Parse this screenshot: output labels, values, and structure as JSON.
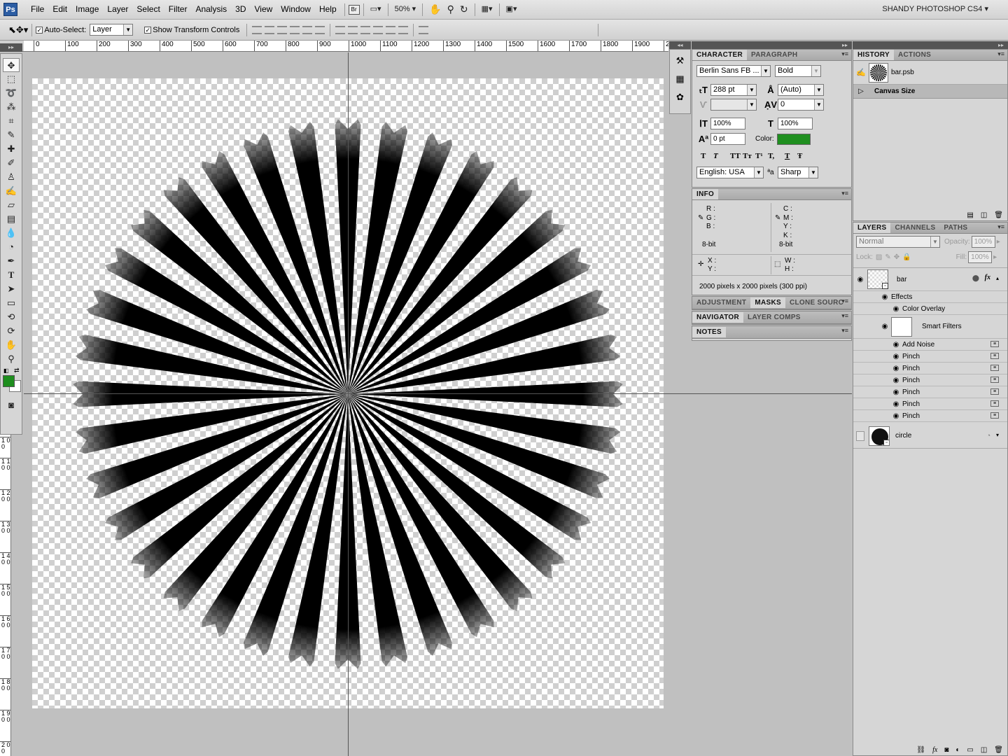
{
  "app": {
    "logo": "Ps",
    "menus": [
      "File",
      "Edit",
      "Image",
      "Layer",
      "Select",
      "Filter",
      "Analysis",
      "3D",
      "View",
      "Window",
      "Help"
    ],
    "bridge_label": "Br",
    "zoom": "50%",
    "workspace": "SHANDY PHOTOSHOP CS4"
  },
  "options": {
    "auto_select_label": "Auto-Select:",
    "auto_select_value": "Layer",
    "show_transform_label": "Show Transform Controls"
  },
  "ruler": {
    "top_ticks": [
      "0",
      "100",
      "200",
      "300",
      "400",
      "500",
      "600",
      "700",
      "800",
      "900",
      "1000",
      "1100",
      "1200",
      "1300",
      "1400",
      "1500",
      "1600",
      "1700",
      "1800",
      "1900",
      "2"
    ],
    "left_ticks": [
      "1 0 0",
      "1 1 0 0",
      "1 2 0 0",
      "1 3 0 0",
      "1 4 0 0",
      "1 5 0 0",
      "1 6 0 0",
      "1 7 0 0",
      "1 8 0 0",
      "1 9 0 0",
      "2 0 0"
    ]
  },
  "tools": [
    "move",
    "marquee",
    "lasso",
    "magic-wand",
    "crop",
    "eyedropper",
    "healing",
    "brush",
    "stamp",
    "history-brush",
    "eraser",
    "gradient",
    "blur",
    "dodge",
    "pen",
    "type",
    "path-select",
    "shape",
    "3d-rotate",
    "3d-orbit",
    "hand",
    "zoom"
  ],
  "colors": {
    "foreground": "#1e8e1e",
    "background": "#ffffff",
    "char_color": "#1f8f1f"
  },
  "character": {
    "tabs": [
      "CHARACTER",
      "PARAGRAPH"
    ],
    "font_family": "Berlin Sans FB ...",
    "font_style": "Bold",
    "size": "288 pt",
    "leading": "(Auto)",
    "kerning": "",
    "tracking": "0",
    "vscale": "100%",
    "hscale": "100%",
    "baseline": "0 pt",
    "color_label": "Color:",
    "language": "English: USA",
    "aa_label": "ªa",
    "antialias": "Sharp",
    "style_buttons": [
      "T",
      "T",
      "TT",
      "Tт",
      "T¹",
      "T,",
      "T",
      "Ŧ"
    ]
  },
  "info": {
    "tab": "INFO",
    "rgb": [
      "R :",
      "G :",
      "B :"
    ],
    "cmyk": [
      "C :",
      "M :",
      "Y :",
      "K :"
    ],
    "bit_left": "8-bit",
    "bit_right": "8-bit",
    "xy": [
      "X :",
      "Y :"
    ],
    "wh": [
      "W :",
      "H :"
    ],
    "doc_info": "2000 pixels x 2000 pixels (300 ppi)"
  },
  "collapsed_panels": [
    {
      "tabs": [
        "ADJUSTMENT",
        "MASKS",
        "CLONE SOURC"
      ],
      "active": 1
    },
    {
      "tabs": [
        "NAVIGATOR",
        "LAYER COMPS"
      ],
      "active": 0
    },
    {
      "tabs": [
        "NOTES"
      ],
      "active": 0
    }
  ],
  "history": {
    "tabs": [
      "HISTORY",
      "ACTIONS"
    ],
    "snapshot": "bar.psb",
    "states": [
      "Canvas Size"
    ]
  },
  "layers": {
    "tabs": [
      "LAYERS",
      "CHANNELS",
      "PATHS"
    ],
    "blend_mode": "Normal",
    "opacity_label": "Opacity:",
    "opacity": "100%",
    "lock_label": "Lock:",
    "fill_label": "Fill:",
    "fill": "100%",
    "items": [
      {
        "name": "bar"
      },
      {
        "name": "circle"
      }
    ],
    "effects_label": "Effects",
    "effect": "Color Overlay",
    "smart_filters_label": "Smart Filters",
    "filters": [
      "Add Noise",
      "Pinch",
      "Pinch",
      "Pinch",
      "Pinch",
      "Pinch",
      "Pinch"
    ]
  },
  "canvas": {
    "ray_count": 36,
    "ray_color": "#000000"
  }
}
